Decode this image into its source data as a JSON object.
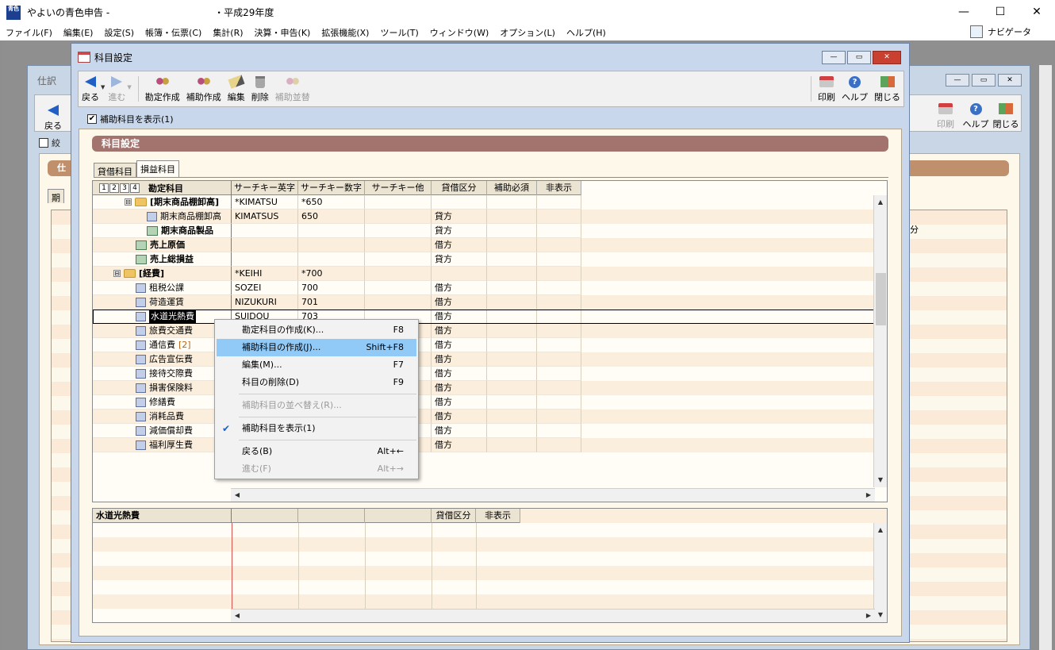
{
  "app": {
    "icon_text": "やよい青色",
    "title": "やよいの青色申告 -　　　　　　　　　　　・平成29年度",
    "window_controls": [
      "—",
      "☐",
      "✕"
    ]
  },
  "menubar": {
    "items": [
      "ファイル(F)",
      "編集(E)",
      "設定(S)",
      "帳簿・伝票(C)",
      "集計(R)",
      "決算・申告(K)",
      "拡張機能(X)",
      "ツール(T)",
      "ウィンドウ(W)",
      "オプション(L)",
      "ヘルプ(H)"
    ],
    "navigator": "ナビゲータ"
  },
  "background_window": {
    "title": "仕訳",
    "back_label": "戻る",
    "check_label": "絞",
    "bar_label": "仕",
    "tab_label": "期",
    "right_buttons": [
      "印刷",
      "ヘルプ",
      "閉じる"
    ],
    "header_fragment": "分"
  },
  "dialog": {
    "title": "科目設定",
    "toolbar": {
      "back": "戻る",
      "forward": "進む",
      "create_account": "勘定作成",
      "create_sub": "補助作成",
      "edit": "編集",
      "delete": "削除",
      "sub_order": "補助並替",
      "print": "印刷",
      "help": "ヘルプ",
      "close": "閉じる"
    },
    "show_sub_check": "補助科目を表示(1)",
    "section_title": "科目設定",
    "tabs": [
      "貸借科目",
      "損益科目"
    ],
    "grid": {
      "level_buttons": [
        "1",
        "2",
        "3",
        "4"
      ],
      "columns": [
        "勘定科目",
        "サーチキー英字",
        "サーチキー数字",
        "サーチキー他",
        "貸借区分",
        "補助必須",
        "非表示"
      ],
      "rows": [
        {
          "indent": 1,
          "toggle": "⊟",
          "icon": "folder",
          "name": "[期末商品棚卸高]",
          "bold": true,
          "en": "*KIMATSU",
          "num": "*650",
          "kubun": ""
        },
        {
          "indent": 2,
          "toggle": "",
          "icon": "book",
          "name": "期末商品棚卸高",
          "bold": false,
          "en": "KIMATSUS",
          "num": "650",
          "kubun": "貸方"
        },
        {
          "indent": 2,
          "toggle": "",
          "icon": "book2",
          "name": "期末商品製品",
          "bold": true,
          "en": "",
          "num": "",
          "kubun": "貸方"
        },
        {
          "indent": 1,
          "toggle": "",
          "icon": "book2",
          "name": "売上原価",
          "bold": true,
          "en": "",
          "num": "",
          "kubun": "借方"
        },
        {
          "indent": 1,
          "toggle": "",
          "icon": "book2",
          "name": "売上総損益",
          "bold": true,
          "en": "",
          "num": "",
          "kubun": "貸方"
        },
        {
          "indent": 0,
          "toggle": "⊟",
          "icon": "folder",
          "name": "[経費]",
          "bold": true,
          "en": "*KEIHI",
          "num": "*700",
          "kubun": ""
        },
        {
          "indent": 1,
          "toggle": "",
          "icon": "book",
          "name": "租税公課",
          "bold": false,
          "en": "SOZEI",
          "num": "700",
          "kubun": "借方"
        },
        {
          "indent": 1,
          "toggle": "",
          "icon": "book",
          "name": "荷造運賃",
          "bold": false,
          "en": "NIZUKURI",
          "num": "701",
          "kubun": "借方"
        },
        {
          "indent": 1,
          "toggle": "",
          "icon": "book",
          "name": "水道光熱費",
          "bold": false,
          "en": "SUIDOU",
          "num": "703",
          "kubun": "借方",
          "selected": true
        },
        {
          "indent": 1,
          "toggle": "",
          "icon": "book",
          "name": "旅費交通費",
          "bold": false,
          "en": "",
          "num": "",
          "kubun": "借方"
        },
        {
          "indent": 1,
          "toggle": "",
          "icon": "book",
          "name": "通信費",
          "count": "[2]",
          "bold": false,
          "en": "",
          "num": "",
          "kubun": "借方"
        },
        {
          "indent": 1,
          "toggle": "",
          "icon": "book",
          "name": "広告宣伝費",
          "bold": false,
          "en": "",
          "num": "",
          "kubun": "借方"
        },
        {
          "indent": 1,
          "toggle": "",
          "icon": "book",
          "name": "接待交際費",
          "bold": false,
          "en": "",
          "num": "",
          "kubun": "借方"
        },
        {
          "indent": 1,
          "toggle": "",
          "icon": "book",
          "name": "損害保険料",
          "bold": false,
          "en": "",
          "num": "",
          "kubun": "借方"
        },
        {
          "indent": 1,
          "toggle": "",
          "icon": "book",
          "name": "修繕費",
          "bold": false,
          "en": "",
          "num": "",
          "kubun": "借方"
        },
        {
          "indent": 1,
          "toggle": "",
          "icon": "book",
          "name": "消耗品費",
          "bold": false,
          "en": "",
          "num": "",
          "kubun": "借方"
        },
        {
          "indent": 1,
          "toggle": "",
          "icon": "book",
          "name": "減価償却費",
          "bold": false,
          "en": "",
          "num": "",
          "kubun": "借方"
        },
        {
          "indent": 1,
          "toggle": "",
          "icon": "book",
          "name": "福利厚生費",
          "bold": false,
          "en": "",
          "num": "",
          "kubun": "借方"
        }
      ]
    },
    "sub_grid": {
      "title": "水道光熱費",
      "columns": [
        "",
        "",
        "",
        "貸借区分",
        "非表示"
      ]
    },
    "context_menu": {
      "items": [
        {
          "label": "勘定科目の作成(K)...",
          "shortcut": "F8",
          "state": "normal"
        },
        {
          "label": "補助科目の作成(J)...",
          "shortcut": "Shift+F8",
          "state": "highlight"
        },
        {
          "label": "編集(M)...",
          "shortcut": "F7",
          "state": "normal"
        },
        {
          "label": "科目の削除(D)",
          "shortcut": "F9",
          "state": "normal",
          "sep_after": true
        },
        {
          "label": "補助科目の並べ替え(R)...",
          "shortcut": "",
          "state": "disabled",
          "sep_after": true
        },
        {
          "label": "補助科目を表示(1)",
          "shortcut": "",
          "state": "checked",
          "sep_after": true
        },
        {
          "label": "戻る(B)",
          "shortcut": "Alt+←",
          "state": "normal"
        },
        {
          "label": "進む(F)",
          "shortcut": "Alt+→",
          "state": "disabled"
        }
      ]
    }
  },
  "colors": {
    "section_bar": "#a3736e",
    "menu_highlight": "#91c9f7",
    "row_alt": "#fbeedc"
  }
}
